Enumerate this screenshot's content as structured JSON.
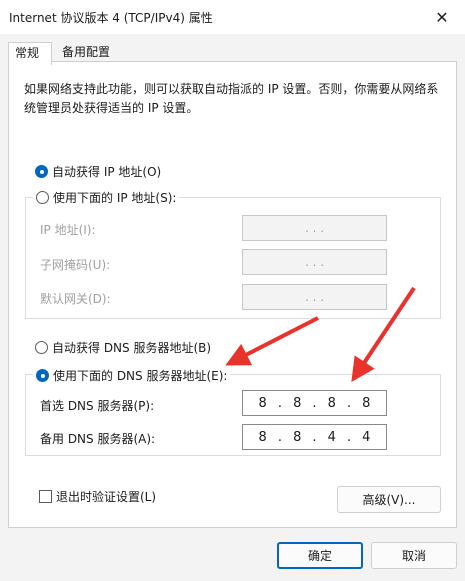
{
  "window": {
    "title": "Internet 协议版本 4 (TCP/IPv4) 属性",
    "close_glyph": "✕"
  },
  "tabs": [
    {
      "label": "常规",
      "active": true
    },
    {
      "label": "备用配置",
      "active": false
    }
  ],
  "description": "如果网络支持此功能，则可以获取自动指派的 IP 设置。否则，你需要从网络系统管理员处获得适当的 IP 设置。",
  "ip_section": {
    "auto_label": "自动获得 IP 地址(O)",
    "auto_selected": true,
    "manual_label": "使用下面的 IP 地址(S):",
    "manual_selected": false,
    "fields": [
      {
        "label": "IP 地址(I):",
        "dots": ".  .  ."
      },
      {
        "label": "子网掩码(U):",
        "dots": ".  .  ."
      },
      {
        "label": "默认网关(D):",
        "dots": ".  .  ."
      }
    ]
  },
  "dns_section": {
    "auto_label": "自动获得 DNS 服务器地址(B)",
    "auto_selected": false,
    "manual_label": "使用下面的 DNS 服务器地址(E):",
    "manual_selected": true,
    "preferred": {
      "label": "首选 DNS 服务器(P):",
      "octets": [
        "8",
        "8",
        "8",
        "8"
      ]
    },
    "alternate": {
      "label": "备用 DNS 服务器(A):",
      "octets": [
        "8",
        "8",
        "4",
        "4"
      ]
    }
  },
  "validate_label": "退出时验证设置(L)",
  "advanced_label": "高级(V)...",
  "ok_label": "确定",
  "cancel_label": "取消",
  "colors": {
    "accent": "#0067c0",
    "arrow": "#e8322b"
  }
}
